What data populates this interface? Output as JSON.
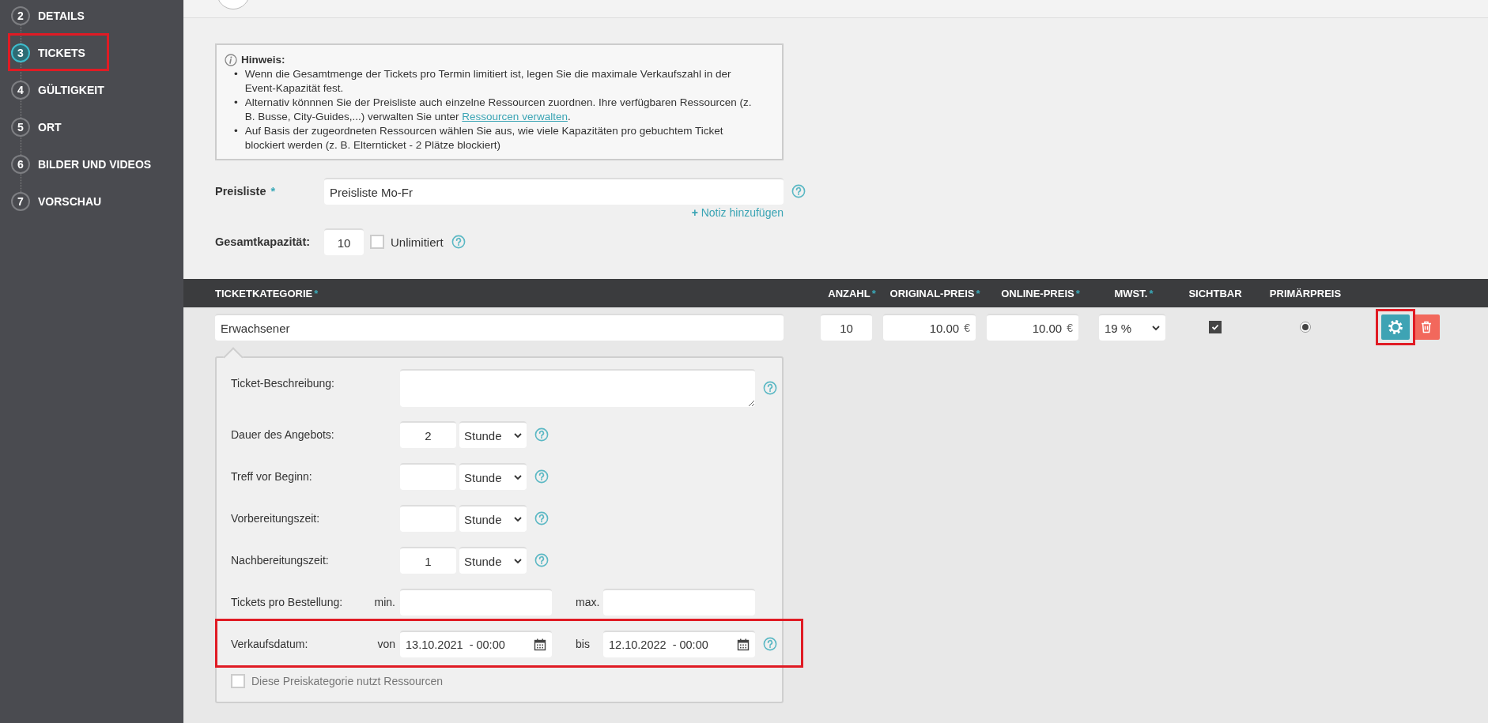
{
  "sidebar": {
    "steps": [
      {
        "number": "2",
        "label": "DETAILS",
        "selected": false
      },
      {
        "number": "3",
        "label": "TICKETS",
        "selected": true,
        "highlighted": true
      },
      {
        "number": "4",
        "label": "GÜLTIGKEIT",
        "selected": false
      },
      {
        "number": "5",
        "label": "ORT",
        "selected": false
      },
      {
        "number": "6",
        "label": "BILDER UND VIDEOS",
        "selected": false
      },
      {
        "number": "7",
        "label": "VORSCHAU",
        "selected": false
      }
    ]
  },
  "hint": {
    "title": "Hinweis:",
    "items": [
      {
        "bullet": "•",
        "text": "Wenn die Gesamtmenge der Tickets pro Termin limitiert ist, legen Sie die maximale Verkaufszahl in der Event-Kapazität fest."
      },
      {
        "bullet": "•",
        "text": "Alternativ könnnen Sie der Preisliste auch einzelne Ressourcen zuordnen. Ihre verfügbaren Ressourcen (z. B. Busse, City-Guides,...) verwalten Sie unter ",
        "link": "Ressourcen verwalten",
        "after": "."
      },
      {
        "bullet": "•",
        "text": "Auf Basis der zugeordneten Ressourcen wählen Sie aus, wie viele Kapazitäten pro gebuchtem Ticket blockiert werden (z. B. Elternticket - 2 Plätze blockiert)"
      }
    ]
  },
  "price_list": {
    "label": "Preisliste",
    "mark": "*",
    "value": "Preisliste Mo-Fr",
    "note_plus": "+",
    "note_link": "Notiz hinzufügen"
  },
  "capacity": {
    "label": "Gesamtkapazität:",
    "value": "10",
    "unlimited_label": "Unlimitiert",
    "unlimited": false
  },
  "table": {
    "columns": [
      {
        "label": "TICKETKATEGORIE",
        "mark": "*"
      },
      {
        "label": "ANZAHL",
        "mark": "*"
      },
      {
        "label": "ORIGINAL-PREIS",
        "mark": "*"
      },
      {
        "label": "ONLINE-PREIS",
        "mark": "*"
      },
      {
        "label": "MWST.",
        "mark": "*"
      },
      {
        "label": "SICHTBAR"
      },
      {
        "label": "PRIMÄRPREIS"
      }
    ],
    "rows": [
      {
        "category": "Erwachsener",
        "count": "10",
        "original_price": "10.00",
        "original_currency": "€",
        "online_price": "10.00",
        "online_currency": "€",
        "vat": "19 %",
        "visible": true,
        "primary": true,
        "settings_highlighted": true,
        "expanded": true
      }
    ]
  },
  "details": {
    "fields": [
      {
        "kind": "textarea",
        "label": "Ticket-Beschreibung:",
        "help": true
      },
      {
        "kind": "duration",
        "label": "Dauer des Angebots:",
        "value": "2",
        "unit": "Stunde",
        "help": true
      },
      {
        "kind": "duration",
        "label": "Treff vor Beginn:",
        "unit": "Stunde",
        "help": true
      },
      {
        "kind": "duration",
        "label": "Vorbereitungszeit:",
        "unit": "Stunde",
        "help": true
      },
      {
        "kind": "duration",
        "label": "Nachbereitungszeit:",
        "value": "1",
        "unit": "Stunde",
        "help": true
      },
      {
        "kind": "minmax",
        "label": "Tickets pro Bestellung:",
        "min_label": "min.",
        "max_label": "max."
      },
      {
        "kind": "daterange",
        "label": "Verkaufsdatum:",
        "from_label": "von",
        "from": "13.10.2021  - 00:00",
        "to_label": "bis",
        "to": "12.10.2022  - 00:00",
        "help": true,
        "highlighted": true
      },
      {
        "kind": "checkbox",
        "label": "Diese Preiskategorie nutzt Ressourcen",
        "checked": false
      }
    ]
  }
}
